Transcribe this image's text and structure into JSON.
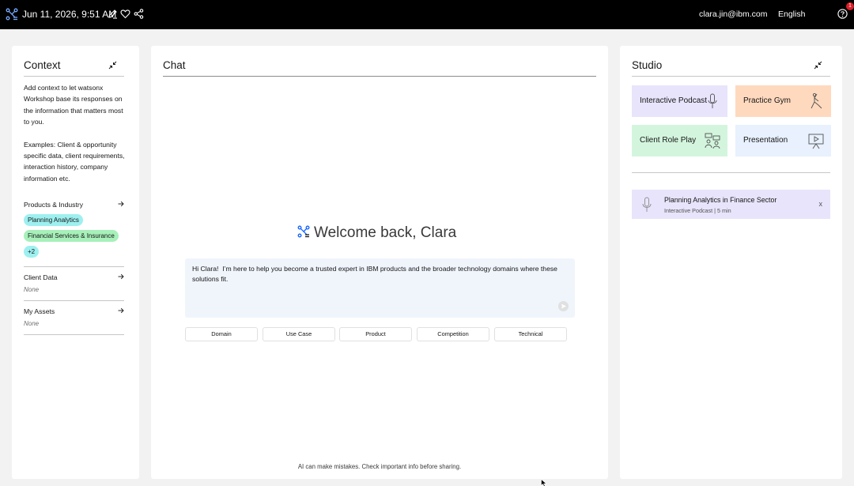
{
  "header": {
    "timestamp": "Jun 11, 2026, 9:51 AM",
    "user_email": "clara.jin@ibm.com",
    "language": "English",
    "notification_count": "1"
  },
  "context": {
    "title": "Context",
    "description": "Add context to let watsonx Workshop base its responses on the information that matters most to you.",
    "examples": "Examples: Client & opportunity specific data, client requirements, interaction history, company information etc.",
    "products_label": "Products & Industry",
    "tags": [
      "Planning Analytics",
      "Financial Services & Insurance",
      "+2"
    ],
    "client_data_label": "Client Data",
    "client_data_value": "None",
    "assets_label": "My Assets",
    "assets_value": "None"
  },
  "chat": {
    "title": "Chat",
    "welcome": "Welcome back, Clara",
    "message": "Hi Clara!  I’m here to help you become a trusted expert in IBM products and the broader technology domains where these solutions fit.",
    "chips": [
      "Domain",
      "Use Case",
      "Product",
      "Competition",
      "Technical"
    ],
    "disclaimer": "AI can make mistakes. Check important info before sharing."
  },
  "studio": {
    "title": "Studio",
    "cards": [
      {
        "label": "Interactive Podcast",
        "color": "#e8e4fb",
        "icon": "microphone-icon"
      },
      {
        "label": "Practice Gym",
        "color": "#ffd9be",
        "icon": "yoga-pose-icon"
      },
      {
        "label": "Client Role Play",
        "color": "#d3f5de",
        "icon": "conversation-icon"
      },
      {
        "label": "Presentation",
        "color": "#e8f1fd",
        "icon": "presentation-icon"
      }
    ],
    "item": {
      "title": "Planning Analytics in Finance Sector",
      "subtitle": "Interactive Podcast | 5 min",
      "close": "x"
    }
  }
}
